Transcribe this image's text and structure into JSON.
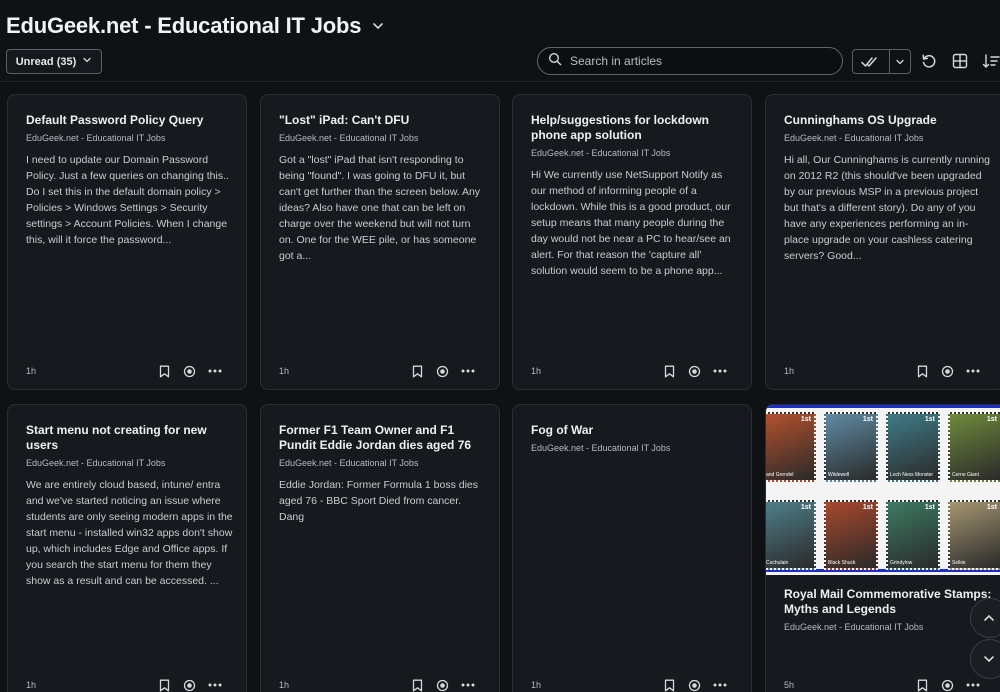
{
  "header": {
    "feed_title": "EduGeek.net - Educational IT Jobs",
    "filter_label": "Unread (35)",
    "search_placeholder": "Search in articles"
  },
  "icons": {
    "title_chevron": "chevron-down-icon",
    "filter_chevron": "chevron-down-icon",
    "search": "search-icon",
    "mark_read": "double-check-icon",
    "mark_read_menu": "chevron-down-icon",
    "refresh": "refresh-icon",
    "layout": "grid-layout-icon",
    "sort": "sort-icon",
    "bookmark": "bookmark-icon",
    "read_status": "circle-dot-icon",
    "more": "more-horizontal-icon",
    "scroll_up": "chevron-up-icon",
    "scroll_down": "chevron-down-icon"
  },
  "colors": {
    "background": "#0f1114",
    "card_background": "#16191d",
    "card_border": "#2b2f35",
    "text_primary": "#eef0f2",
    "text_secondary": "#b6bac0"
  },
  "articles": [
    {
      "title": "Default Password Policy Query",
      "source": "EduGeek.net - Educational IT Jobs",
      "excerpt": "I need to update our Domain Password Policy. Just a few queries on changing this.. Do I set this in the default domain policy > Policies > Windows Settings > Security settings > Account Policies. When I change this, will it force the password...",
      "time": "1h"
    },
    {
      "title": "\"Lost\" iPad: Can't DFU",
      "source": "EduGeek.net - Educational IT Jobs",
      "excerpt": "Got a \"lost\" iPad that isn't responding to being \"found\". I was going to DFU it, but can't get further than the screen below. Any ideas? Also have one that can be left on charge over the weekend but will not turn on. One for the WEE pile, or has someone got a...",
      "time": "1h"
    },
    {
      "title": "Help/suggestions for lockdown phone app solution",
      "source": "EduGeek.net - Educational IT Jobs",
      "excerpt": "Hi We currently use NetSupport Notify as our method of informing people of a lockdown. While this is a good product, our setup means that many people during the day would not be near a PC to hear/see an alert. For that reason the 'capture all' solution would seem to be a phone app...",
      "time": "1h"
    },
    {
      "title": "Cunninghams OS Upgrade",
      "source": "EduGeek.net - Educational IT Jobs",
      "excerpt": "Hi all, Our Cunninghams is currently running on 2012 R2 (this should've been upgraded by our previous MSP in a previous project but that's a different story). Do any of you have any experiences performing an in-place upgrade on your cashless catering servers? Good...",
      "time": "1h"
    },
    {
      "title": "Start menu not creating for new users",
      "source": "EduGeek.net - Educational IT Jobs",
      "excerpt": "We are entirely cloud based, intune/ entra and we've started noticing an issue where students are only seeing modern apps in the start menu - installed win32 apps don't show up, which includes Edge and Office apps. If you search the start menu for them they show as a result and can be accessed. ...",
      "time": "1h"
    },
    {
      "title": "Former F1 Team Owner and F1 Pundit Eddie Jordan dies aged 76",
      "source": "EduGeek.net - Educational IT Jobs",
      "excerpt": "Eddie Jordan: Former Formula 1 boss dies aged 76 - BBC Sport Died from cancer. Dang",
      "time": "1h"
    },
    {
      "title": "Fog of War",
      "source": "EduGeek.net - Educational IT Jobs",
      "excerpt": "",
      "time": "1h"
    },
    {
      "title": "Royal Mail Commemorative Stamps: Myths and Legends",
      "source": "EduGeek.net - Educational IT Jobs",
      "excerpt": "",
      "time": "5h",
      "stamps": [
        {
          "value": "1st",
          "caption": "and Grendel",
          "color": "#b4512d"
        },
        {
          "value": "1st",
          "caption": "Wiidewell",
          "color": "#5f8ba3"
        },
        {
          "value": "1st",
          "caption": "Loch Ness Monster",
          "color": "#3f7b86"
        },
        {
          "value": "1st",
          "caption": "Cerne Giant",
          "color": "#6f8a3a"
        },
        {
          "value": "1st",
          "caption": "Cuchulain",
          "color": "#4f7f8a"
        },
        {
          "value": "1st",
          "caption": "Black Shuck",
          "color": "#a8482c"
        },
        {
          "value": "1st",
          "caption": "Grindylow",
          "color": "#3c7a62"
        },
        {
          "value": "1st",
          "caption": "Selkie",
          "color": "#a59670"
        }
      ]
    }
  ]
}
